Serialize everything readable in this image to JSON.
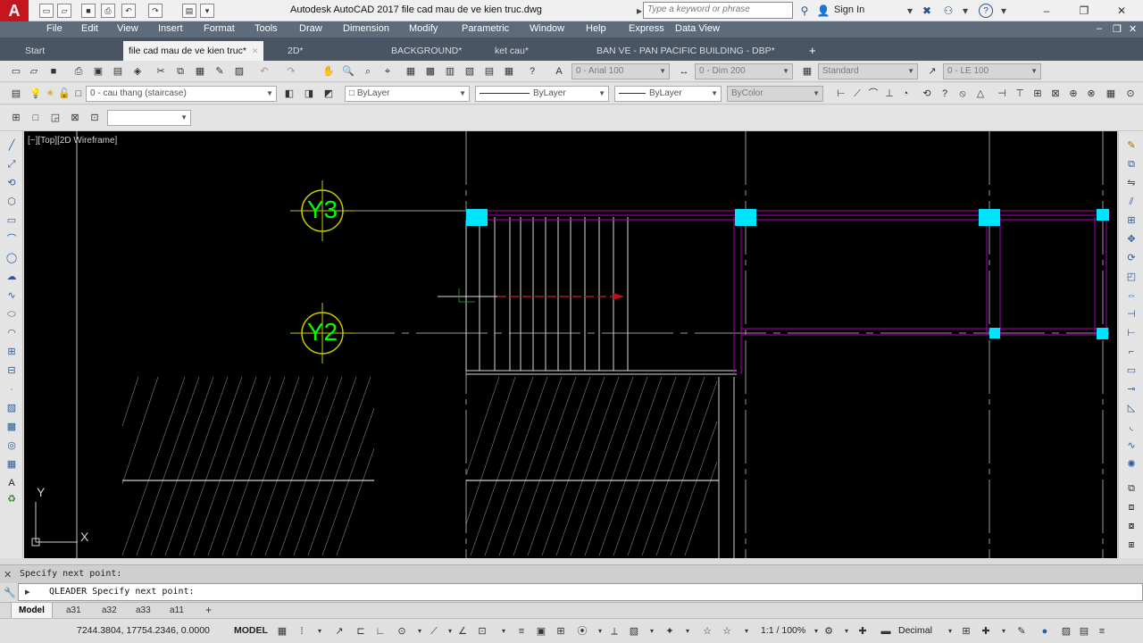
{
  "app": {
    "logo": "A",
    "title": "Autodesk AutoCAD 2017    file cad mau de ve kien truc.dwg",
    "search_placeholder": "Type a keyword or phrase",
    "sign_in": "Sign In",
    "help": "?"
  },
  "menu": [
    "File",
    "Edit",
    "View",
    "Insert",
    "Format",
    "Tools",
    "Draw",
    "Dimension",
    "Modify",
    "Parametric",
    "Window",
    "Help",
    "Express",
    "Data View"
  ],
  "tabs": [
    {
      "label": "Start",
      "active": false
    },
    {
      "label": "file cad mau de ve kien truc*",
      "active": true
    },
    {
      "label": "2D*",
      "active": false
    },
    {
      "label": "BACKGROUND*",
      "active": false
    },
    {
      "label": "ket cau*",
      "active": false
    },
    {
      "label": "BAN VE - PAN PACIFIC BUILDING - DBP*",
      "active": false
    }
  ],
  "toolbar1": {
    "text_style": "0 - Arial 100",
    "dim_style": "0 - Dim 200",
    "table_style": "Standard",
    "mleader_style": "0 - LE 100"
  },
  "toolbar2": {
    "layer": "0 - cau thang (staircase)",
    "color": "ByLayer",
    "linetype": "ByLayer",
    "lineweight": "ByLayer",
    "plotstyle": "ByColor"
  },
  "viewport": {
    "label": "[−][Top][2D Wireframe]",
    "grid_bubbles": [
      "Y3",
      "Y2"
    ],
    "ucs_y": "Y",
    "ucs_x": "X"
  },
  "command": {
    "history": "Specify next point:",
    "current": "QLEADER Specify next point:"
  },
  "layout_tabs": [
    {
      "label": "Model",
      "active": true
    },
    {
      "label": "a31",
      "active": false
    },
    {
      "label": "a32",
      "active": false
    },
    {
      "label": "a33",
      "active": false
    },
    {
      "label": "a11",
      "active": false
    },
    {
      "label": "+",
      "active": false
    }
  ],
  "status": {
    "coords": "7244.3804, 17754.2346, 0.0000",
    "space": "MODEL",
    "scale": "1:1 / 100%",
    "units": "Decimal"
  },
  "colors": {
    "menubar": "#5e6b7b",
    "tabbar": "#4a5564",
    "viewport": "#000000",
    "grid_bubble": "#c8c800",
    "grid_text": "#00ff00",
    "beam": "#b000b0",
    "column": "#00e5ff"
  }
}
